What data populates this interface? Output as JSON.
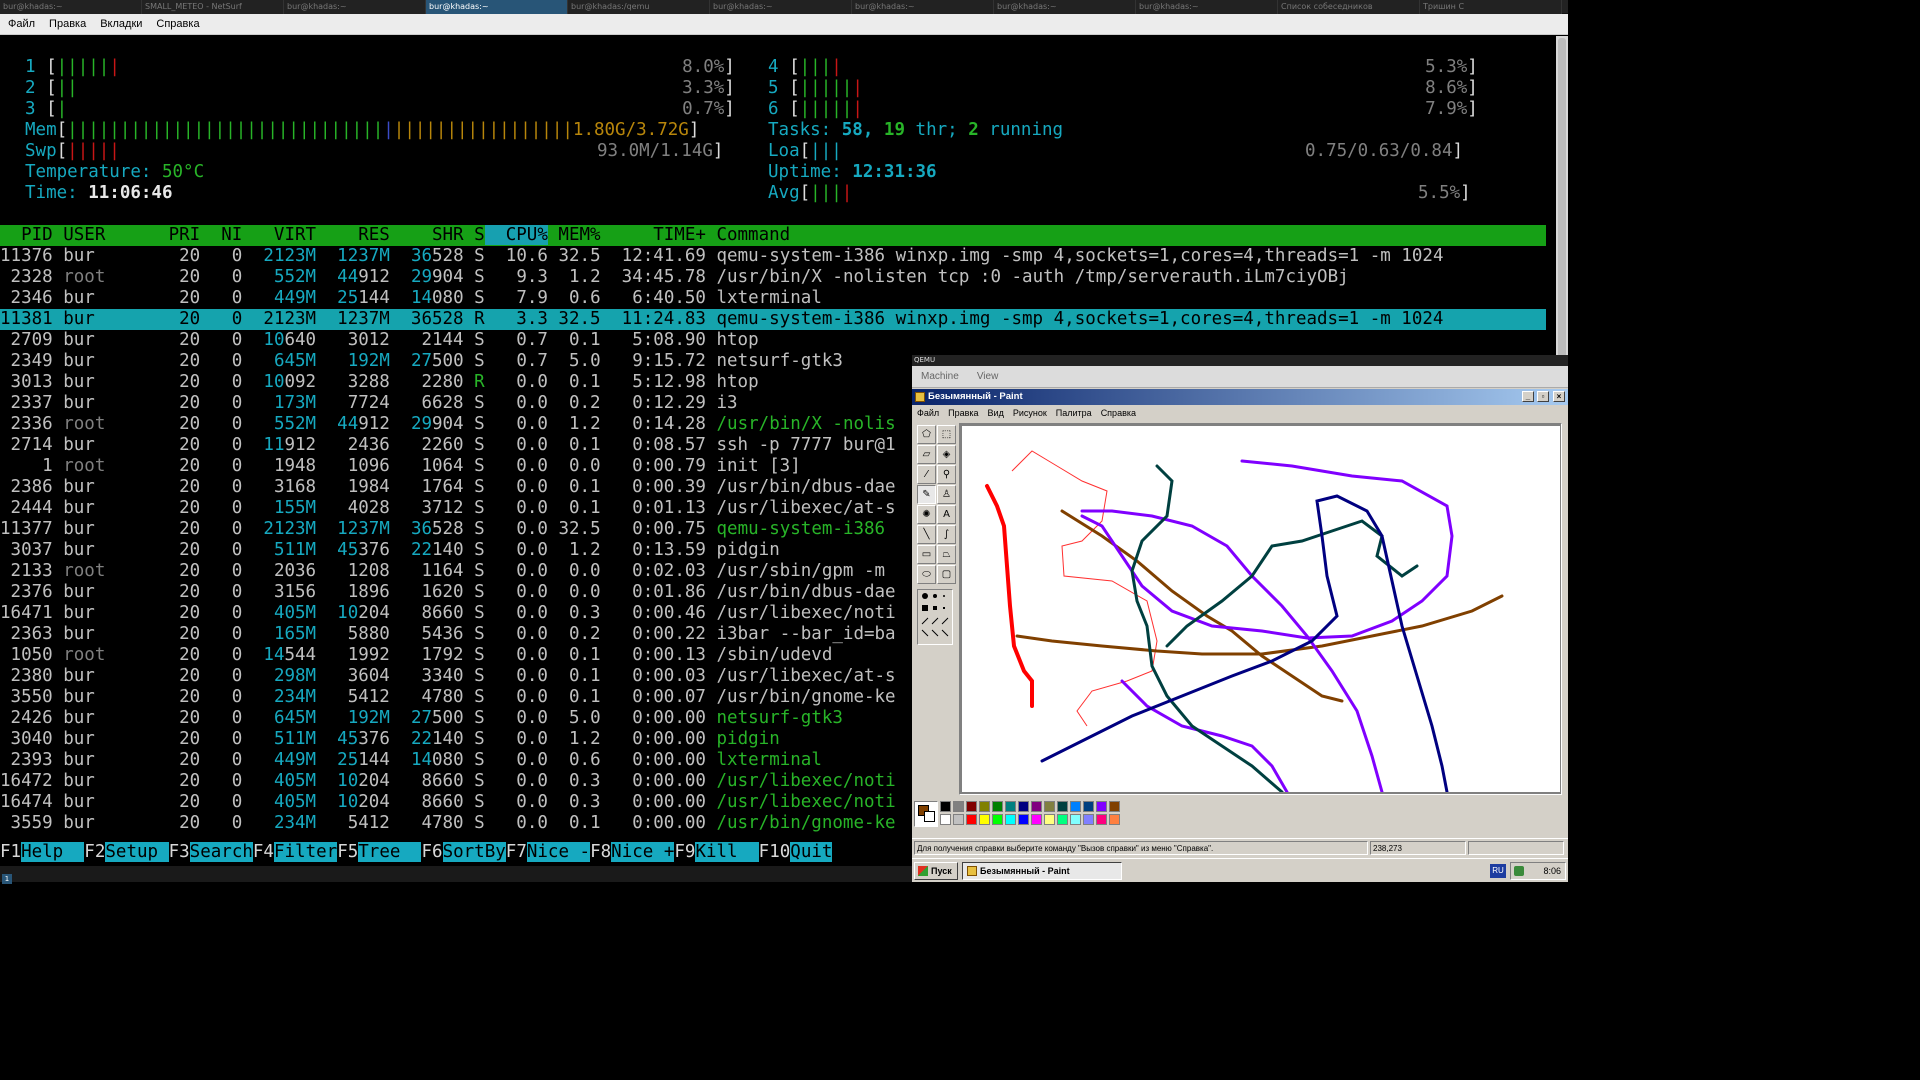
{
  "workspace_tabs": [
    "bur@khadas:~",
    "SMALL_METEO - NetSurf",
    "bur@khadas:~",
    "bur@khadas:~",
    "bur@khadas:/qemu",
    "bur@khadas:~",
    "bur@khadas:~",
    "bur@khadas:~",
    "bur@khadas:~",
    "Список собеседников",
    "Тришин С"
  ],
  "terminal_menu": [
    "Файл",
    "Правка",
    "Вкладки",
    "Справка"
  ],
  "htop": {
    "cpus": [
      {
        "n": "1",
        "pct": "8.0%"
      },
      {
        "n": "2",
        "pct": "3.3%"
      },
      {
        "n": "3",
        "pct": "0.7%"
      },
      {
        "n": "4",
        "pct": "5.3%"
      },
      {
        "n": "5",
        "pct": "8.6%"
      },
      {
        "n": "6",
        "pct": "7.9%"
      }
    ],
    "mem_label": "Mem",
    "mem_value": "1.80G/3.72G",
    "swp_label": "Swp",
    "swp_value": "93.0M/1.14G",
    "temperature_label": "Temperature:",
    "temperature_value": "50°C",
    "time_label": "Time:",
    "time_value": "11:06:46",
    "tasks_label": "Tasks:",
    "tasks_total": "58,",
    "threads": "19",
    "thr_label": "thr;",
    "running": "2",
    "running_label": "running",
    "load_label": "Loa",
    "load_value": "0.75/0.63/0.84",
    "uptime_label": "Uptime:",
    "uptime_value": "12:31:36",
    "avg_label": "Avg",
    "avg_value": "5.5%",
    "columns": {
      "pid": "  PID",
      "user": "USER",
      "pri": "PRI",
      "ni": "NI",
      "virt": "VIRT",
      "res": "RES",
      "shr": "SHR",
      "s": "S",
      "cpu": "CPU%",
      "mem": "MEM%",
      "time": "TIME+",
      "cmd": "Command"
    },
    "processes": [
      {
        "pid": "11376",
        "user": "bur",
        "pri": "20",
        "ni": "0",
        "virt": "2123M",
        "res": "1237M",
        "shr": "36528",
        "s": "S",
        "cpu": "10.6",
        "mem": "32.5",
        "time": "12:41.69",
        "cmd": "qemu-system-i386 winxp.img -smp 4,sockets=1,cores=4,threads=1 -m 1024"
      },
      {
        "pid": "2328",
        "user": "root",
        "pri": "20",
        "ni": "0",
        "virt": "552M",
        "res": "44912",
        "shr": "29904",
        "s": "S",
        "cpu": "9.3",
        "mem": "1.2",
        "time": "34:45.78",
        "cmd": "/usr/bin/X -nolisten tcp :0 -auth /tmp/serverauth.iLm7ciyOBj"
      },
      {
        "pid": "2346",
        "user": "bur",
        "pri": "20",
        "ni": "0",
        "virt": "449M",
        "res": "25144",
        "shr": "14080",
        "s": "S",
        "cpu": "7.9",
        "mem": "0.6",
        "time": "6:40.50",
        "cmd": "lxterminal"
      },
      {
        "pid": "11381",
        "user": "bur",
        "pri": "20",
        "ni": "0",
        "virt": "2123M",
        "res": "1237M",
        "shr": "36528",
        "s": "R",
        "cpu": "3.3",
        "mem": "32.5",
        "time": "11:24.83",
        "cmd": "qemu-system-i386 winxp.img -smp 4,sockets=1,cores=4,threads=1 -m 1024"
      },
      {
        "pid": "2709",
        "user": "bur",
        "pri": "20",
        "ni": "0",
        "virt": "10640",
        "res": "3012",
        "shr": "2144",
        "s": "S",
        "cpu": "0.7",
        "mem": "0.1",
        "time": "5:08.90",
        "cmd": "htop"
      },
      {
        "pid": "2349",
        "user": "bur",
        "pri": "20",
        "ni": "0",
        "virt": "645M",
        "res": "192M",
        "shr": "27500",
        "s": "S",
        "cpu": "0.7",
        "mem": "5.0",
        "time": "9:15.72",
        "cmd": "netsurf-gtk3"
      },
      {
        "pid": "3013",
        "user": "bur",
        "pri": "20",
        "ni": "0",
        "virt": "10092",
        "res": "3288",
        "shr": "2280",
        "s": "R",
        "cpu": "0.0",
        "mem": "0.1",
        "time": "5:12.98",
        "cmd": "htop"
      },
      {
        "pid": "2337",
        "user": "bur",
        "pri": "20",
        "ni": "0",
        "virt": "173M",
        "res": "7724",
        "shr": "6628",
        "s": "S",
        "cpu": "0.0",
        "mem": "0.2",
        "time": "0:12.29",
        "cmd": "i3"
      },
      {
        "pid": "2336",
        "user": "root",
        "pri": "20",
        "ni": "0",
        "virt": "552M",
        "res": "44912",
        "shr": "29904",
        "s": "S",
        "cpu": "0.0",
        "mem": "1.2",
        "time": "0:14.28",
        "cmd": "/usr/bin/X -nolis"
      },
      {
        "pid": "2714",
        "user": "bur",
        "pri": "20",
        "ni": "0",
        "virt": "11912",
        "res": "2436",
        "shr": "2260",
        "s": "S",
        "cpu": "0.0",
        "mem": "0.1",
        "time": "0:08.57",
        "cmd": "ssh -p 7777 bur@1"
      },
      {
        "pid": "1",
        "user": "root",
        "pri": "20",
        "ni": "0",
        "virt": "1948",
        "res": "1096",
        "shr": "1064",
        "s": "S",
        "cpu": "0.0",
        "mem": "0.0",
        "time": "0:00.79",
        "cmd": "init [3]"
      },
      {
        "pid": "2386",
        "user": "bur",
        "pri": "20",
        "ni": "0",
        "virt": "3168",
        "res": "1984",
        "shr": "1764",
        "s": "S",
        "cpu": "0.0",
        "mem": "0.1",
        "time": "0:00.39",
        "cmd": "/usr/bin/dbus-dae"
      },
      {
        "pid": "2444",
        "user": "bur",
        "pri": "20",
        "ni": "0",
        "virt": "155M",
        "res": "4028",
        "shr": "3712",
        "s": "S",
        "cpu": "0.0",
        "mem": "0.1",
        "time": "0:01.13",
        "cmd": "/usr/libexec/at-s"
      },
      {
        "pid": "11377",
        "user": "bur",
        "pri": "20",
        "ni": "0",
        "virt": "2123M",
        "res": "1237M",
        "shr": "36528",
        "s": "S",
        "cpu": "0.0",
        "mem": "32.5",
        "time": "0:00.75",
        "cmd": "qemu-system-i386"
      },
      {
        "pid": "3037",
        "user": "bur",
        "pri": "20",
        "ni": "0",
        "virt": "511M",
        "res": "45376",
        "shr": "22140",
        "s": "S",
        "cpu": "0.0",
        "mem": "1.2",
        "time": "0:13.59",
        "cmd": "pidgin"
      },
      {
        "pid": "2133",
        "user": "root",
        "pri": "20",
        "ni": "0",
        "virt": "2036",
        "res": "1208",
        "shr": "1164",
        "s": "S",
        "cpu": "0.0",
        "mem": "0.0",
        "time": "0:02.03",
        "cmd": "/usr/sbin/gpm -m"
      },
      {
        "pid": "2376",
        "user": "bur",
        "pri": "20",
        "ni": "0",
        "virt": "3156",
        "res": "1896",
        "shr": "1620",
        "s": "S",
        "cpu": "0.0",
        "mem": "0.0",
        "time": "0:01.86",
        "cmd": "/usr/bin/dbus-dae"
      },
      {
        "pid": "16471",
        "user": "bur",
        "pri": "20",
        "ni": "0",
        "virt": "405M",
        "res": "10204",
        "shr": "8660",
        "s": "S",
        "cpu": "0.0",
        "mem": "0.3",
        "time": "0:00.46",
        "cmd": "/usr/libexec/noti"
      },
      {
        "pid": "2363",
        "user": "bur",
        "pri": "20",
        "ni": "0",
        "virt": "165M",
        "res": "5880",
        "shr": "5436",
        "s": "S",
        "cpu": "0.0",
        "mem": "0.2",
        "time": "0:00.22",
        "cmd": "i3bar --bar_id=ba"
      },
      {
        "pid": "1050",
        "user": "root",
        "pri": "20",
        "ni": "0",
        "virt": "14544",
        "res": "1992",
        "shr": "1792",
        "s": "S",
        "cpu": "0.0",
        "mem": "0.1",
        "time": "0:00.13",
        "cmd": "/sbin/udevd"
      },
      {
        "pid": "2380",
        "user": "bur",
        "pri": "20",
        "ni": "0",
        "virt": "298M",
        "res": "3604",
        "shr": "3340",
        "s": "S",
        "cpu": "0.0",
        "mem": "0.1",
        "time": "0:00.03",
        "cmd": "/usr/libexec/at-s"
      },
      {
        "pid": "3550",
        "user": "bur",
        "pri": "20",
        "ni": "0",
        "virt": "234M",
        "res": "5412",
        "shr": "4780",
        "s": "S",
        "cpu": "0.0",
        "mem": "0.1",
        "time": "0:00.07",
        "cmd": "/usr/bin/gnome-ke"
      },
      {
        "pid": "2426",
        "user": "bur",
        "pri": "20",
        "ni": "0",
        "virt": "645M",
        "res": "192M",
        "shr": "27500",
        "s": "S",
        "cpu": "0.0",
        "mem": "5.0",
        "time": "0:00.00",
        "cmd": "netsurf-gtk3"
      },
      {
        "pid": "3040",
        "user": "bur",
        "pri": "20",
        "ni": "0",
        "virt": "511M",
        "res": "45376",
        "shr": "22140",
        "s": "S",
        "cpu": "0.0",
        "mem": "1.2",
        "time": "0:00.00",
        "cmd": "pidgin"
      },
      {
        "pid": "2393",
        "user": "bur",
        "pri": "20",
        "ni": "0",
        "virt": "449M",
        "res": "25144",
        "shr": "14080",
        "s": "S",
        "cpu": "0.0",
        "mem": "0.6",
        "time": "0:00.00",
        "cmd": "lxterminal"
      },
      {
        "pid": "16472",
        "user": "bur",
        "pri": "20",
        "ni": "0",
        "virt": "405M",
        "res": "10204",
        "shr": "8660",
        "s": "S",
        "cpu": "0.0",
        "mem": "0.3",
        "time": "0:00.00",
        "cmd": "/usr/libexec/noti"
      },
      {
        "pid": "16474",
        "user": "bur",
        "pri": "20",
        "ni": "0",
        "virt": "405M",
        "res": "10204",
        "shr": "8660",
        "s": "S",
        "cpu": "0.0",
        "mem": "0.3",
        "time": "0:00.00",
        "cmd": "/usr/libexec/noti"
      },
      {
        "pid": "3559",
        "user": "bur",
        "pri": "20",
        "ni": "0",
        "virt": "234M",
        "res": "5412",
        "shr": "4780",
        "s": "S",
        "cpu": "0.0",
        "mem": "0.1",
        "time": "0:00.00",
        "cmd": "/usr/bin/gnome-ke"
      }
    ],
    "fkeys": [
      {
        "k": "F1",
        "l": "Help  "
      },
      {
        "k": "F2",
        "l": "Setup "
      },
      {
        "k": "F3",
        "l": "Search"
      },
      {
        "k": "F4",
        "l": "Filter"
      },
      {
        "k": "F5",
        "l": "Tree  "
      },
      {
        "k": "F6",
        "l": "SortBy"
      },
      {
        "k": "F7",
        "l": "Nice -"
      },
      {
        "k": "F8",
        "l": "Nice +"
      },
      {
        "k": "F9",
        "l": "Kill  "
      },
      {
        "k": "F10",
        "l": "Quit"
      }
    ]
  },
  "terminal_status_workspace": "1",
  "qemu": {
    "title": "QEMU",
    "menu": [
      "Machine",
      "View"
    ],
    "paint": {
      "title": "Безымянный - Paint",
      "menu": [
        "Файл",
        "Правка",
        "Вид",
        "Рисунок",
        "Палитра",
        "Справка"
      ],
      "status_text": "Для получения справки выберите команду \"Вызов справки\" из меню \"Справка\".",
      "coords": "238,273",
      "palette_top": [
        "#000000",
        "#808080",
        "#800000",
        "#808000",
        "#008000",
        "#008080",
        "#000080",
        "#800080",
        "#808040",
        "#004040",
        "#0080ff",
        "#004080",
        "#8000ff",
        "#804000"
      ],
      "palette_bottom": [
        "#ffffff",
        "#c0c0c0",
        "#ff0000",
        "#ffff00",
        "#00ff00",
        "#00ffff",
        "#0000ff",
        "#ff00ff",
        "#ffff80",
        "#00ff80",
        "#80ffff",
        "#8080ff",
        "#ff0080",
        "#ff8040"
      ],
      "current_fg": "#804000"
    },
    "taskbar": {
      "start": "Пуск",
      "task": "Безымянный - Paint",
      "lang": "RU",
      "clock": "8:06"
    }
  }
}
